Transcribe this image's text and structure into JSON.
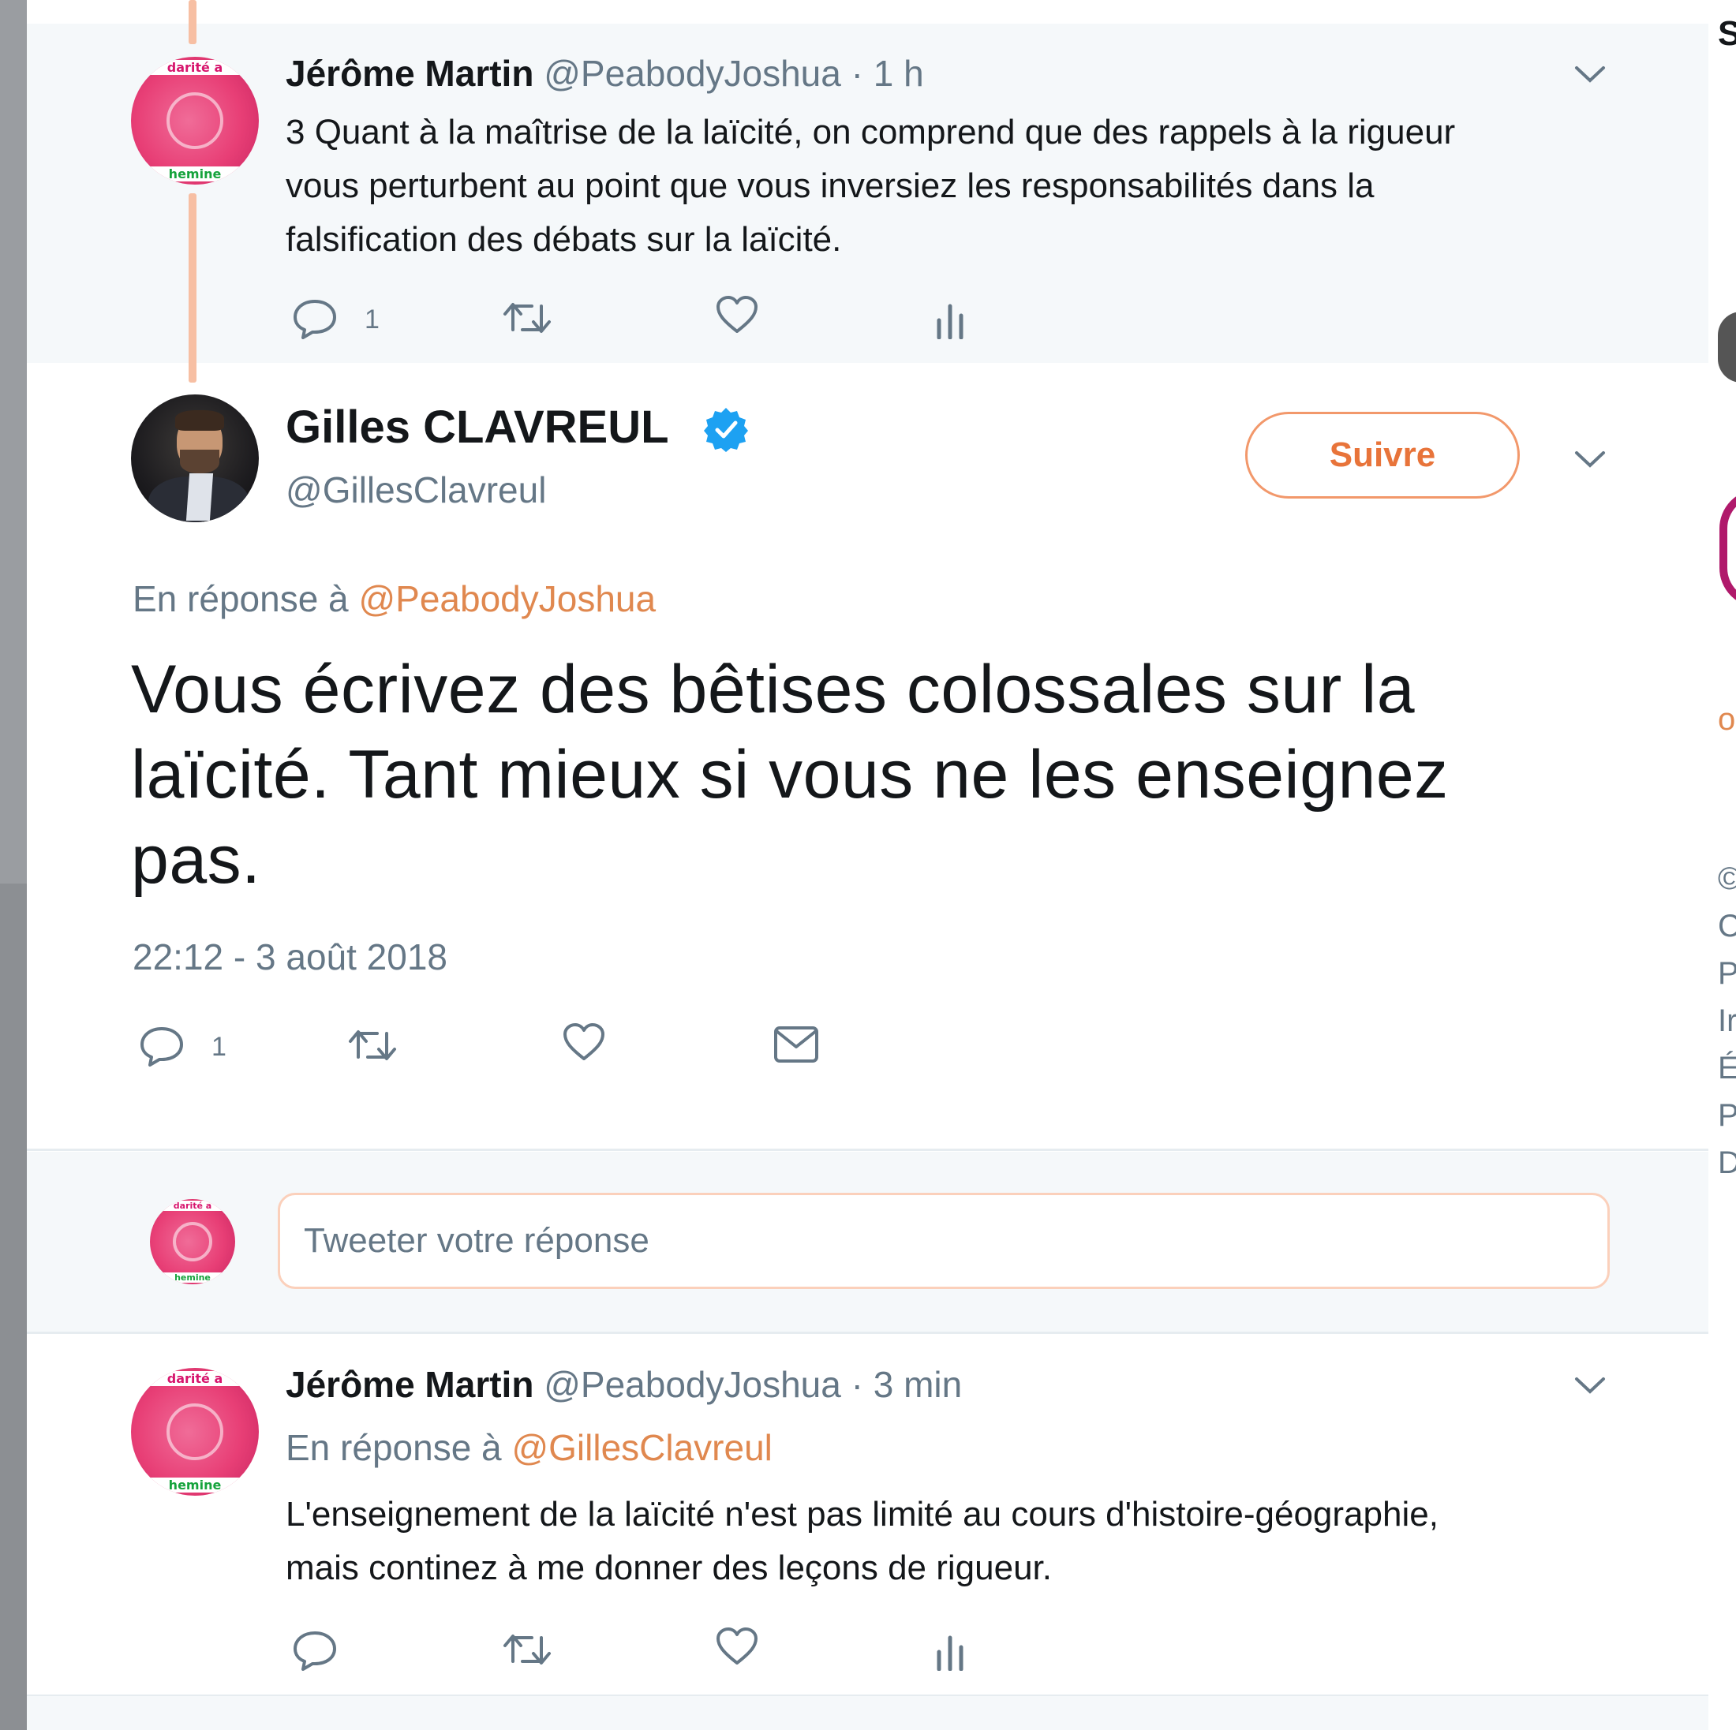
{
  "tweet_prev": {
    "author_name": "Jérôme Martin",
    "author_handle": "@PeabodyJoshua",
    "time": "· 1 h",
    "text_lines": [
      "3 Quant à la maîtrise de la laïcité, on comprend que des rappels à la rigueur",
      "vous perturbent au point que vous inversiez les responsabilités dans la",
      "falsification des débats sur la laïcité."
    ],
    "reply_count": "1"
  },
  "main_tweet": {
    "author_name": "Gilles CLAVREUL",
    "author_handle": "@GillesClavreul",
    "verified": true,
    "follow_label": "Suivre",
    "reply_prefix": "En réponse à",
    "reply_to": "@PeabodyJoshua",
    "text_lines": [
      "Vous écrivez des bêtises colossales sur la",
      "laïcité. Tant mieux si vous ne les enseignez",
      "pas."
    ],
    "timestamp": "22:12 - 3 août 2018",
    "reply_count": "1"
  },
  "reply_box": {
    "placeholder": "Tweeter votre réponse"
  },
  "tweet_reply": {
    "author_name": "Jérôme Martin",
    "author_handle": "@PeabodyJoshua",
    "time": "· 3 min",
    "reply_prefix": "En réponse à",
    "reply_to": "@GillesClavreul",
    "text_lines": [
      "L'enseignement de la laïcité n'est pas limité au cours d'histoire-géographie,",
      "mais continez à me donner des leçons de rigueur."
    ]
  },
  "avatar_text": {
    "top": "darité a",
    "bottom": "hemine"
  },
  "right_sidebar_fragments": {
    "top_letter": "S",
    "line_1": "©",
    "line_2": "C",
    "line_3": "P",
    "line_4": "Ir",
    "line_5": "É",
    "line_6": "P",
    "line_7": "D",
    "link_fragment": "o"
  },
  "colors": {
    "accent": "#e8743a",
    "link": "#e0884f",
    "muted": "#657786",
    "verified": "#1da1f2",
    "thread_line": "#f7bfa3",
    "muted_bg": "#f5f8fa"
  },
  "icons": {
    "reply": "reply-icon",
    "retweet": "retweet-icon",
    "like": "heart-icon",
    "analytics": "analytics-icon",
    "dm": "envelope-icon",
    "menu": "chevron-down-icon",
    "verified": "verified-badge-icon"
  }
}
